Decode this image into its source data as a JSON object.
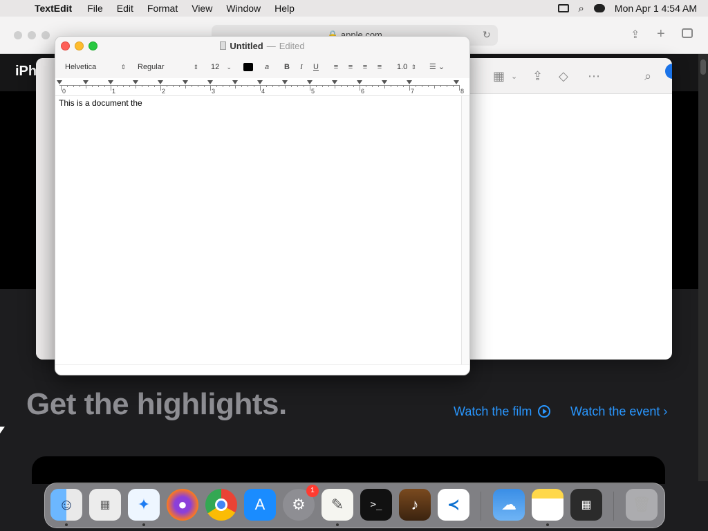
{
  "menubar": {
    "app_name": "TextEdit",
    "items": [
      "File",
      "Edit",
      "Format",
      "View",
      "Window",
      "Help"
    ],
    "clock": "Mon Apr 1  4:54 AM"
  },
  "safari": {
    "url": "apple.com",
    "nav_text": "iPh",
    "headline": "Get the highlights.",
    "watch_film": "Watch the film",
    "watch_event": "Watch the event"
  },
  "textedit": {
    "title": "Untitled",
    "title_sep": "—",
    "status": "Edited",
    "font_family": "Helvetica",
    "font_style": "Regular",
    "font_size": "12",
    "line_spacing": "1.0",
    "bold_label": "B",
    "italic_label": "I",
    "underline_label": "U",
    "ruler_numbers": [
      "0",
      "1",
      "2",
      "3",
      "4",
      "5",
      "6",
      "7",
      "8"
    ],
    "body_text": "This is a document the",
    "text_color": "#000000"
  },
  "dock": {
    "items": [
      "Finder",
      "Launchpad",
      "Safari",
      "Firefox",
      "Chrome",
      "App Store",
      "System Settings",
      "TextEdit",
      "Terminal",
      "GarageBand",
      "Visual Studio Code",
      "Weather",
      "Notes",
      "Calculator",
      "Trash"
    ],
    "settings_badge": "1"
  },
  "colors": {
    "accent_link": "#2997ff",
    "close": "#fe5f57",
    "minimize": "#febc2e",
    "maximize": "#28c840"
  }
}
